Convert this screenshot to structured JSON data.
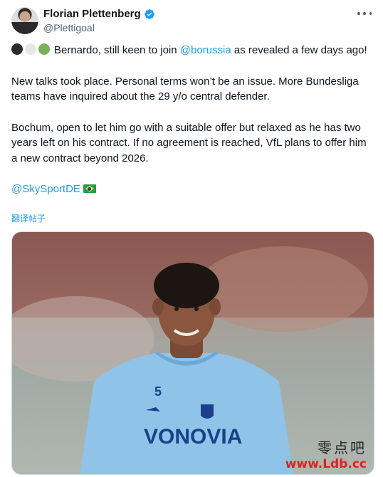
{
  "tweet": {
    "display_name": "Florian Plettenberg",
    "handle": "@Plettigoal",
    "more_icon": "more-horizontal-icon",
    "line1_before_mention": "Bernardo, still keen to join ",
    "line1_mention": "@borussia",
    "line1_after_mention": " as revealed a few days ago!",
    "para2": "New talks took place. Personal terms won’t be an issue. More Bundesliga teams have inquired about the 29 y/o central defender.",
    "para3": "Bochum, open to let him go with a suitable offer but relaxed as he has two years left on his contract. If no agreement is reached, VfL plans to offer him a new contract beyond 2026.",
    "source_mention": "@SkySportDE",
    "translate_label": "翻译帖子",
    "accent_color": "#1d9bf0"
  },
  "photo": {
    "shirt_number": "5",
    "shirt_sponsor": "VONOVIA"
  },
  "watermark": {
    "chinese": "零点吧",
    "url": "www.Ldb.cc"
  }
}
